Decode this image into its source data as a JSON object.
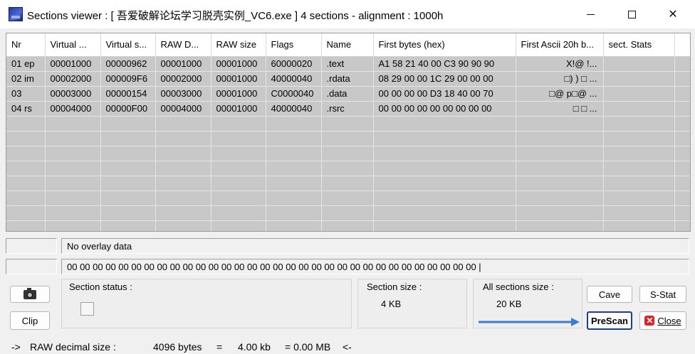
{
  "window": {
    "title": "Sections viewer : [ 吾爱破解论坛学习脱壳实例_VC6.exe ] 4 sections - alignment : 1000h",
    "controls": {
      "minimize": "─",
      "maximize": "☐",
      "close": "✕"
    }
  },
  "table": {
    "columns": [
      "Nr",
      "Virtual ...",
      "Virtual s...",
      "RAW D...",
      "RAW size",
      "Flags",
      "Name",
      "First bytes (hex)",
      "First Ascii 20h b...",
      "sect. Stats"
    ],
    "rows": [
      [
        "01 ep",
        "00001000",
        "00000962",
        "00001000",
        "00001000",
        "60000020",
        ".text",
        "A1 58 21 40 00 C3 90 90 90",
        "X!@            !...",
        ""
      ],
      [
        "02 im",
        "00002000",
        "000009F6",
        "00002000",
        "00001000",
        "40000040",
        ".rdata",
        "08 29 00 00 1C 29 00 00 00",
        "□) )      □      ...",
        ""
      ],
      [
        "03",
        "00003000",
        "00000154",
        "00003000",
        "00001000",
        "C0000040",
        ".data",
        "00 00 00 00 D3 18 40 00 70",
        "□@ p□@   ...",
        ""
      ],
      [
        "04 rs",
        "00004000",
        "00000F00",
        "00004000",
        "00001000",
        "40000040",
        ".rsrc",
        "00 00 00 00 00 00 00 00 00",
        "□ □   ...",
        ""
      ]
    ]
  },
  "overlay": {
    "text": "No overlay data"
  },
  "hexline": {
    "text": "00 00 00 00 00 00 00 00 00 00 00 00 00 00 00 00 00 00 00 00 00 00 00 00 00 00 00 00 00 00 00 00   |"
  },
  "section_status": {
    "label": "Section status :"
  },
  "section_size": {
    "label": "Section size :",
    "value": "4 KB"
  },
  "all_sections_size": {
    "label": "All sections size :",
    "value": "20 KB"
  },
  "buttons": {
    "camera_icon": "camera-icon",
    "clip": "Clip",
    "cave": "Cave",
    "sstat": "S-Stat",
    "prescan": "PreScan",
    "close": "Close"
  },
  "status_bar": {
    "prefix": "->",
    "label": "RAW decimal size :",
    "bytes": "4096 bytes",
    "eq1": "=",
    "kb": "4.00 kb",
    "mb": "= 0.00 MB",
    "suffix": "<-"
  },
  "colors": {
    "accent_arrow": "#3a7bd5",
    "prescan_border": "#1f3f80",
    "close_icon": "#d8252a"
  }
}
